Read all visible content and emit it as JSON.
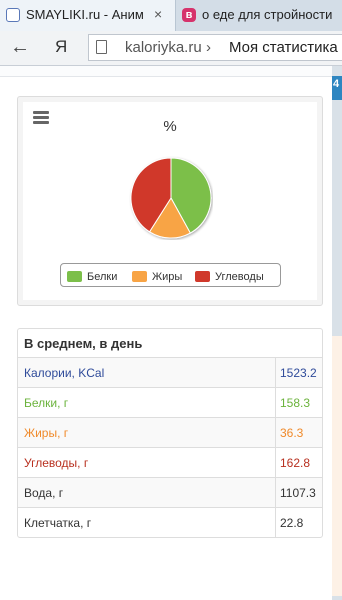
{
  "browser": {
    "tabs": [
      {
        "title": "SMAYLIKI.ru - Анимац",
        "close": "×"
      },
      {
        "title": "о еде для стройности",
        "favicon_letter": "в"
      }
    ],
    "back_glyph": "←",
    "yandex_logo": "Я",
    "domain": "kaloriyka.ru",
    "separator": "›",
    "page_title": "Моя статистика"
  },
  "right_strip_letter": "4",
  "chart": {
    "title": "%"
  },
  "chart_data": {
    "type": "pie",
    "title": "%",
    "slices": [
      {
        "label": "Белки",
        "value": 42,
        "color": "#7cbf4a"
      },
      {
        "label": "Жиры",
        "value": 17,
        "color": "#f8a445"
      },
      {
        "label": "Углеводы",
        "value": 41,
        "color": "#d0392b"
      }
    ]
  },
  "stats": {
    "header": "В среднем, в день",
    "rows": [
      {
        "label": "Калории, KCal",
        "value": "1523.2",
        "color": "#2f4b9a"
      },
      {
        "label": "Белки, г",
        "value": "158.3",
        "color": "#6bb33c"
      },
      {
        "label": "Жиры, г",
        "value": "36.3",
        "color": "#f08a2a"
      },
      {
        "label": "Углеводы, г",
        "value": "162.8",
        "color": "#b8301f"
      },
      {
        "label": "Вода, г",
        "value": "1107.3",
        "color": "#333333"
      },
      {
        "label": "Клетчатка, г",
        "value": "22.8",
        "color": "#333333"
      }
    ]
  }
}
